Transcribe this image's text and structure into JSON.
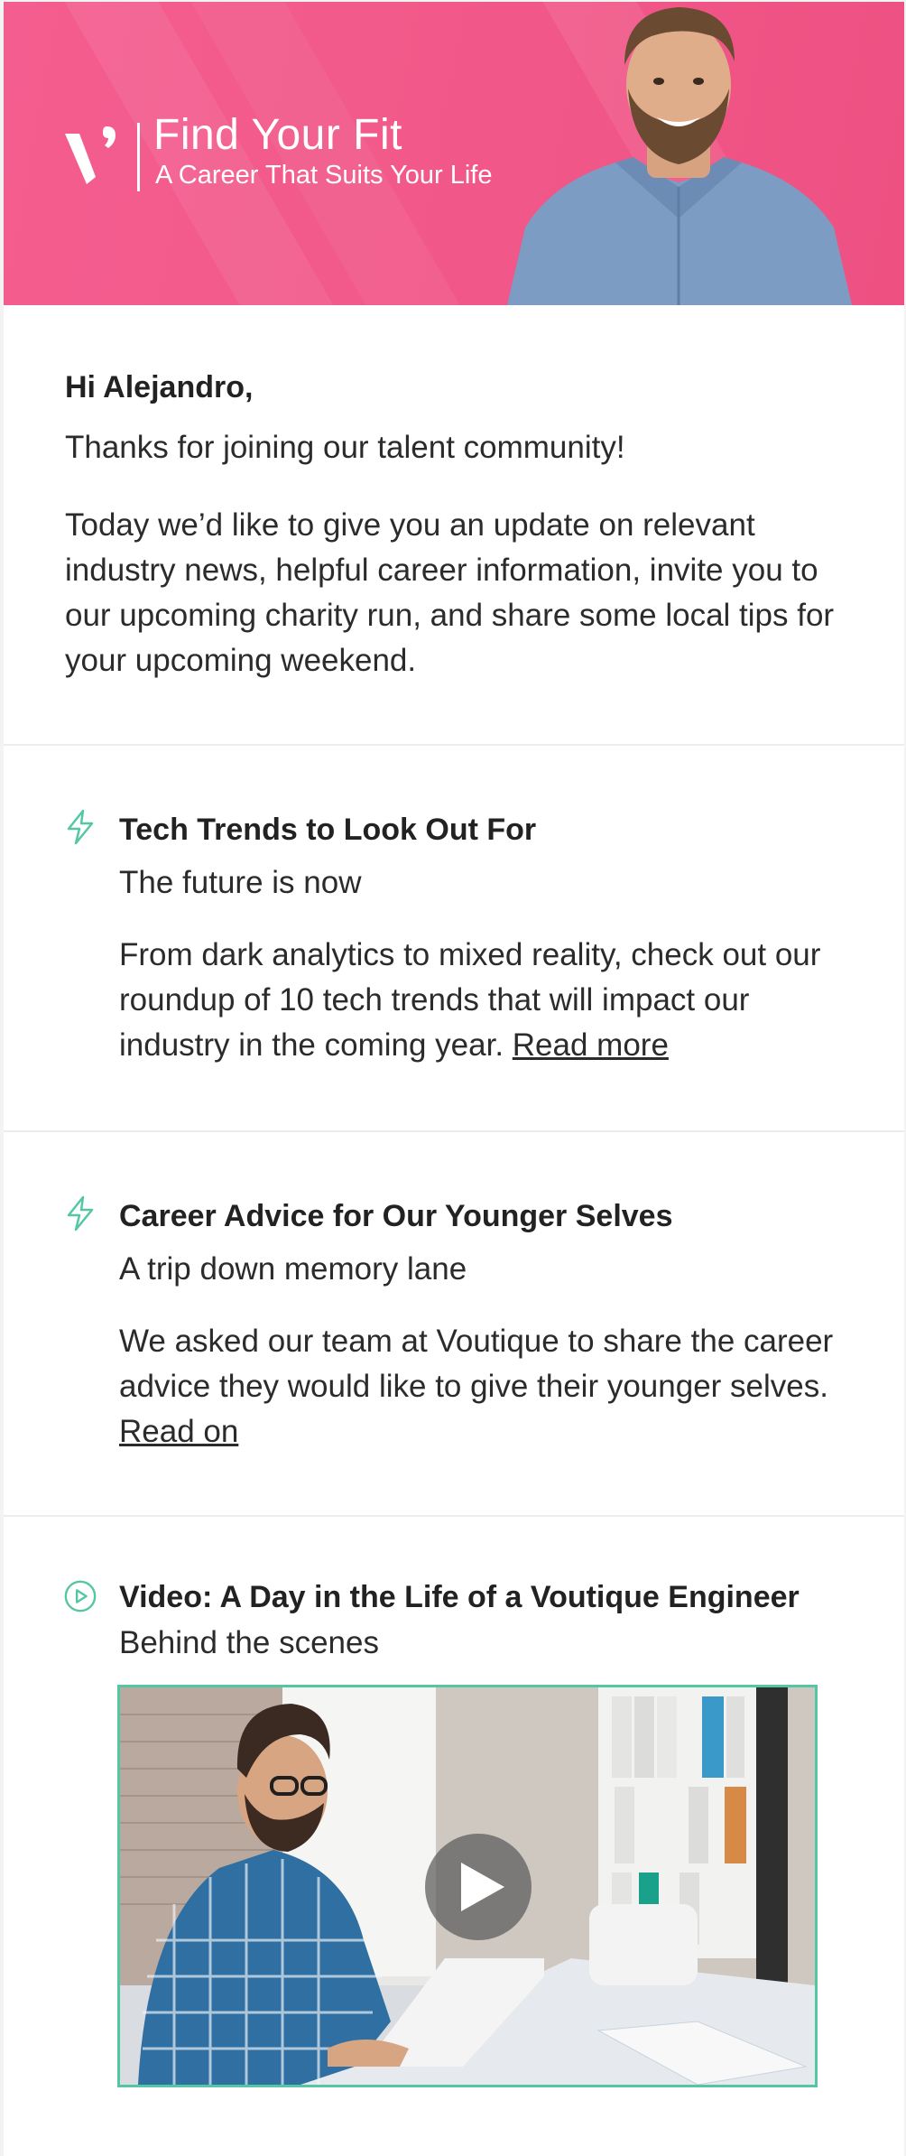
{
  "banner": {
    "title": "Find Your Fit",
    "subtitle": "A Career That Suits Your Life",
    "background_color": "#f25a8b"
  },
  "greeting": "Hi Alejandro,",
  "intro": "Thanks for joining our talent community!",
  "body": "Today we’d like to give you an update on relevant industry news, helpful career information, invite you to our upcoming charity run, and share some local tips for your upcoming weekend.",
  "sections": [
    {
      "icon": "lightning-icon",
      "title": "Tech Trends to Look Out For",
      "subtitle": "The future is now",
      "text": "From dark analytics to mixed reality, check out our roundup of 10 tech trends that will impact our industry in the coming year. ",
      "link": "Read more"
    },
    {
      "icon": "lightning-icon",
      "title": "Career Advice for Our Younger Selves",
      "subtitle": "A trip down memory lane",
      "text": "We asked our team at Voutique to share the career advice they would like to give their younger selves. ",
      "link": "Read on"
    },
    {
      "icon": "play-circle-icon",
      "title": "Video: A Day in the Life of a Voutique Engineer",
      "subtitle": "Behind the scenes"
    }
  ],
  "accent_color": "#55c6a4"
}
